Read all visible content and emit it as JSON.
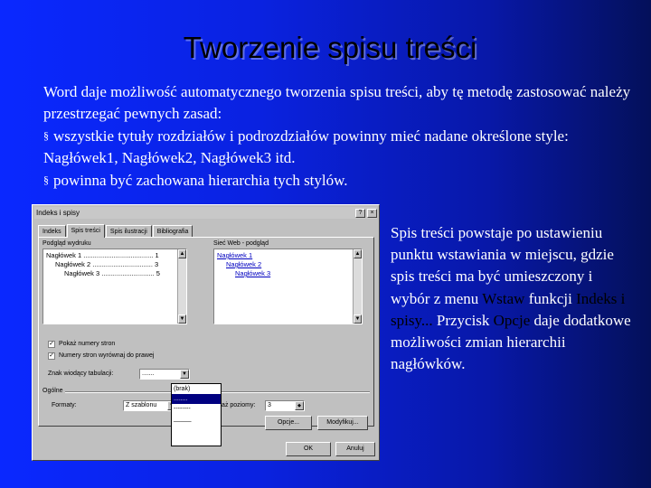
{
  "slide": {
    "title": "Tworzenie spisu treści",
    "intro_para": "Word daje możliwość automatycznego tworzenia spisu treści, aby tę metodę zastosować należy przestrzegać pewnych zasad:",
    "bullet1": "wszystkie tytuły rozdziałów i podrozdziałów powinny mieć nadane określone style: Nagłówek1, Nagłówek2, Nagłówek3 itd.",
    "bullet2": "powinna być zachowana hierarchia tych stylów.",
    "bullet_glyph": "§",
    "side": {
      "p1": "Spis treści powstaje po ustawieniu punktu wstawiania w miejscu, gdzie spis treści ma być umieszczony i wybór z menu",
      "hl1": "Wstaw",
      "p2": "funkcji",
      "hl2": "Indeks i spisy...",
      "p3": "Przycisk",
      "hl3": "Opcje",
      "p4": "daje dodatkowe możliwości zmian hierarchii nagłówków."
    }
  },
  "dialog": {
    "title": "Indeks i spisy",
    "help_btn": "?",
    "close_btn": "×",
    "tabs": [
      "Indeks",
      "Spis treści",
      "Spis ilustracji",
      "Bibliografia"
    ],
    "print_preview_label": "Podgląd wydruku",
    "print_preview_lines": [
      "Nagłówek 1 ..................................... 1",
      "Nagłówek 2 ................................ 3",
      "Nagłówek 3 ............................ 5"
    ],
    "web_preview_label": "Sieć Web - podgląd",
    "web_preview_links": [
      "Nagłówek 1",
      "Nagłówek 2",
      "Nagłówek 3"
    ],
    "show_page_numbers_label": "Pokaż numery stron",
    "align_right_label": "Numery stron wyrównaj do prawej",
    "tab_leader_label": "Znak wiodący tabulacji:",
    "tab_leader_value": ".......",
    "leader_options": [
      "(brak)",
      "........",
      "--------",
      "_____"
    ],
    "general_label": "Ogólne",
    "formats_label": "Formaty:",
    "formats_value": "Z szablonu",
    "levels_label": "Pokaż poziomy:",
    "levels_value": "3",
    "options_button": "Opcje...",
    "modify_button": "Modyfikuj...",
    "ok_button": "OK",
    "cancel_button": "Anuluj",
    "check_mark": "✓"
  }
}
